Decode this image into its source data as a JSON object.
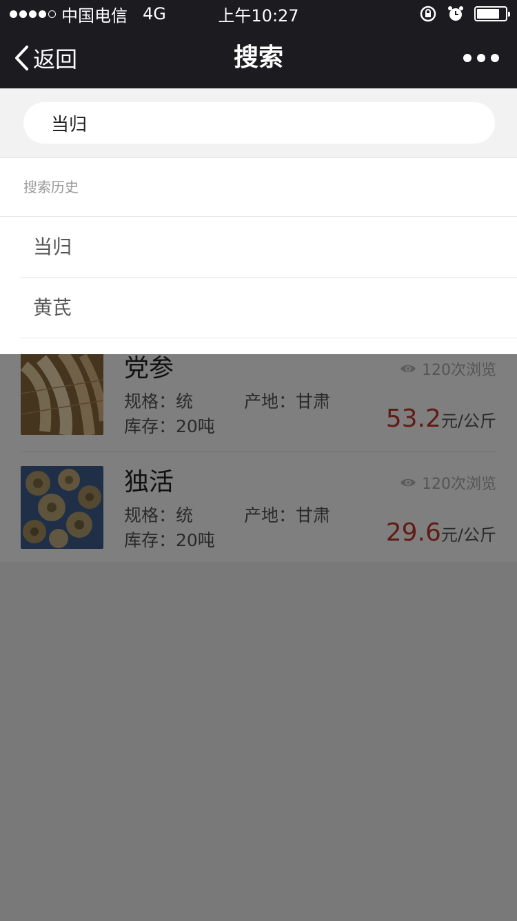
{
  "status_bar": {
    "carrier": "中国电信",
    "network": "4G",
    "time": "上午10:27",
    "signal_filled": 4,
    "signal_total": 5,
    "battery_level": 0.8
  },
  "nav": {
    "back_label": "返回",
    "title": "搜索"
  },
  "search": {
    "value": "当归",
    "placeholder": ""
  },
  "history": {
    "title": "搜索历史",
    "items": [
      "当归",
      "黄芪"
    ]
  },
  "results": [
    {
      "name": "党参",
      "views": "120次浏览",
      "spec": "规格：统",
      "origin": "产地：甘肃",
      "stock": "库存：20吨",
      "price": "53.2",
      "unit": "元/公斤"
    },
    {
      "name": "独活",
      "views": "120次浏览",
      "spec": "规格：统",
      "origin": "产地：甘肃",
      "stock": "库存：20吨",
      "price": "29.6",
      "unit": "元/公斤"
    }
  ],
  "colors": {
    "header_bg": "#1c1b20",
    "price": "#c0392b",
    "overlay": "rgba(0,0,0,0.5)"
  }
}
